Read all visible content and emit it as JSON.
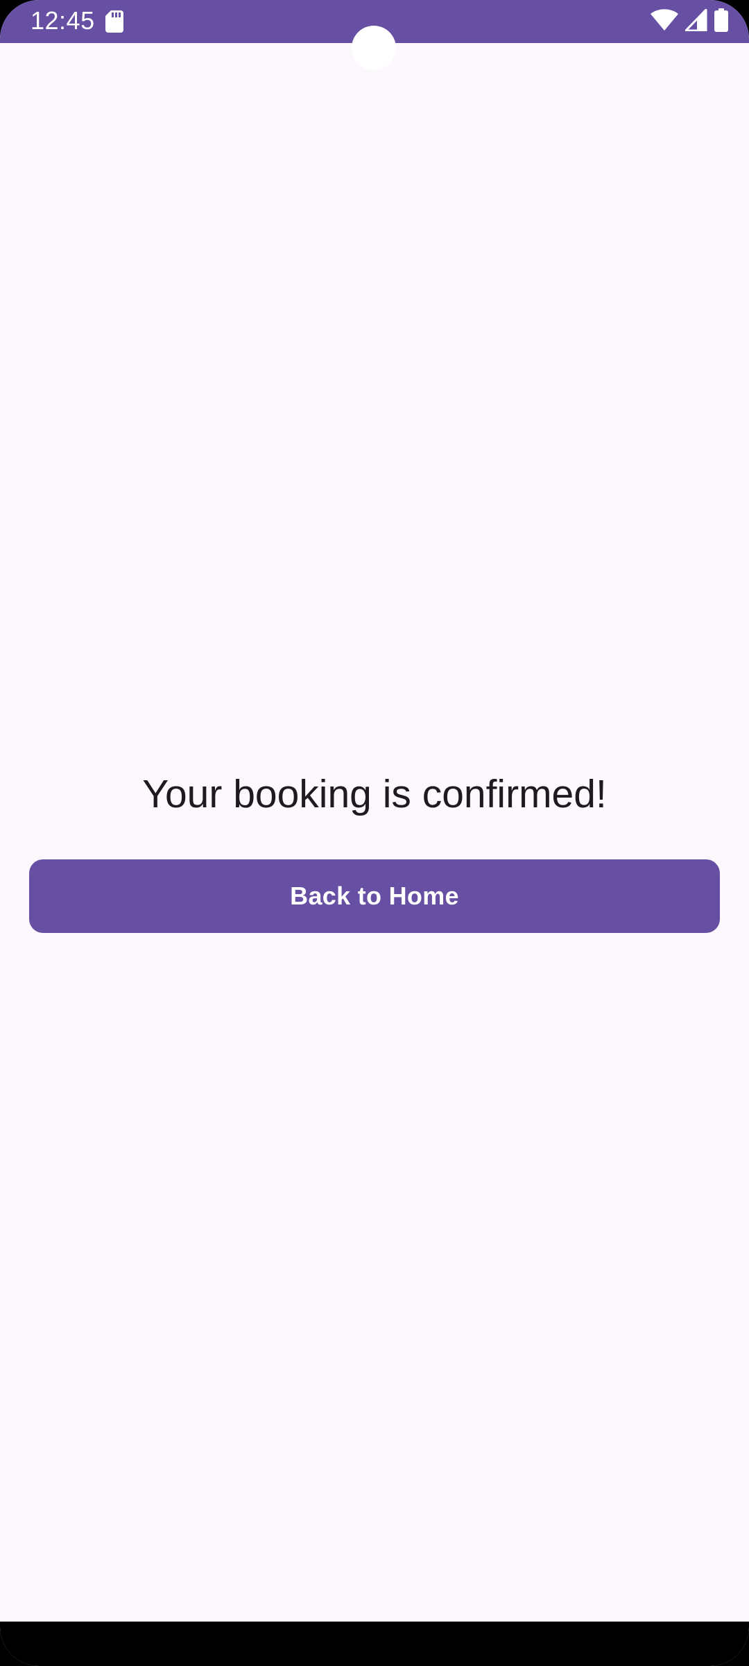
{
  "status_bar": {
    "time": "12:45",
    "background": "#6750A4",
    "icons": [
      "sd-card-icon",
      "wifi-icon",
      "cell-signal-icon",
      "battery-icon"
    ]
  },
  "main": {
    "message": "Your booking is confirmed!",
    "back_button_label": "Back to Home"
  },
  "colors": {
    "primary": "#6750A4",
    "background": "#FDF7FE",
    "on_surface": "#1D1B20"
  }
}
